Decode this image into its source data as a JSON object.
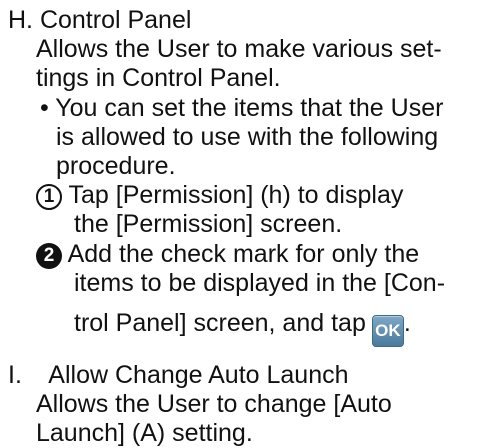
{
  "section_h": {
    "heading": "H. Control Panel",
    "desc_line1": "Allows the User to make various set-",
    "desc_line2": "tings in Control Panel.",
    "bullet_line1": "• You can set the items that the User",
    "bullet_line2": "is allowed to use with the following",
    "bullet_line3": "procedure.",
    "step1_marker": "1",
    "step1_line1": "Tap [Permission] (h) to display",
    "step1_line2": "the [Permission] screen.",
    "step2_marker": "2",
    "step2_line1": "Add the check mark for only the",
    "step2_line2": "items to be displayed in the [Con-",
    "step2_line3": "trol Panel] screen, and tap",
    "step2_end": ".",
    "ok_button_label": "OK"
  },
  "section_i": {
    "heading": "I.    Allow Change Auto Launch",
    "desc_line1": "Allows the User to change [Auto",
    "desc_line2": "Launch] (A) setting."
  }
}
